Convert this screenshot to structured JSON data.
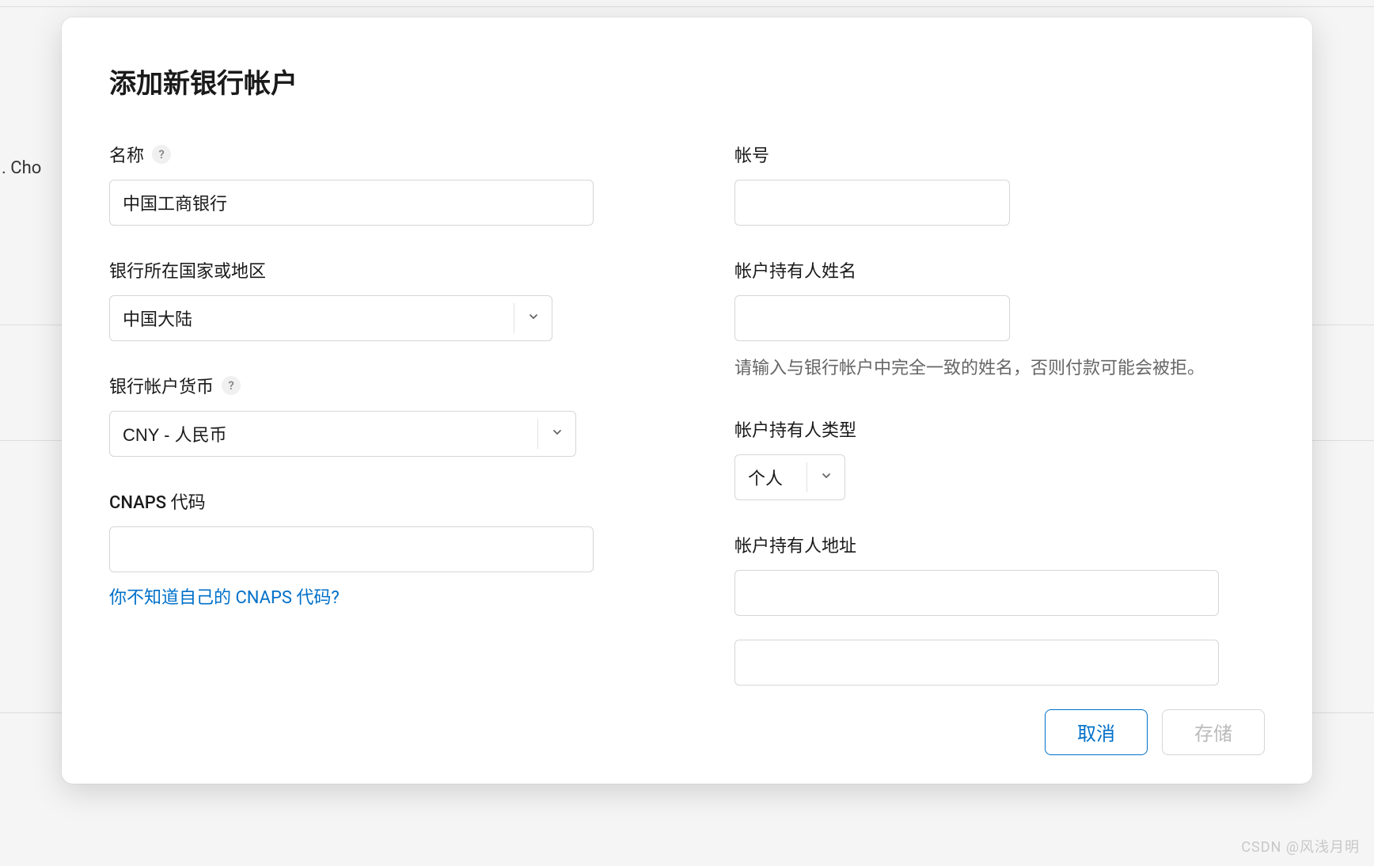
{
  "background": {
    "partial_text": ". Cho"
  },
  "modal": {
    "title": "添加新银行帐户",
    "left": {
      "name": {
        "label": "名称",
        "value": "中国工商银行"
      },
      "country": {
        "label": "银行所在国家或地区",
        "value": "中国大陆"
      },
      "currency": {
        "label": "银行帐户货币",
        "value": "CNY - 人民币"
      },
      "cnaps": {
        "label": "CNAPS 代码",
        "value": "",
        "help_link": "你不知道自己的 CNAPS 代码?"
      }
    },
    "right": {
      "account_number": {
        "label": "帐号",
        "value": ""
      },
      "holder_name": {
        "label": "帐户持有人姓名",
        "value": "",
        "hint": "请输入与银行帐户中完全一致的姓名，否则付款可能会被拒。"
      },
      "holder_type": {
        "label": "帐户持有人类型",
        "value": "个人"
      },
      "holder_address": {
        "label": "帐户持有人地址",
        "line1": "",
        "line2": ""
      }
    },
    "footer": {
      "cancel": "取消",
      "save": "存储"
    }
  },
  "watermark": "CSDN @风浅月明"
}
